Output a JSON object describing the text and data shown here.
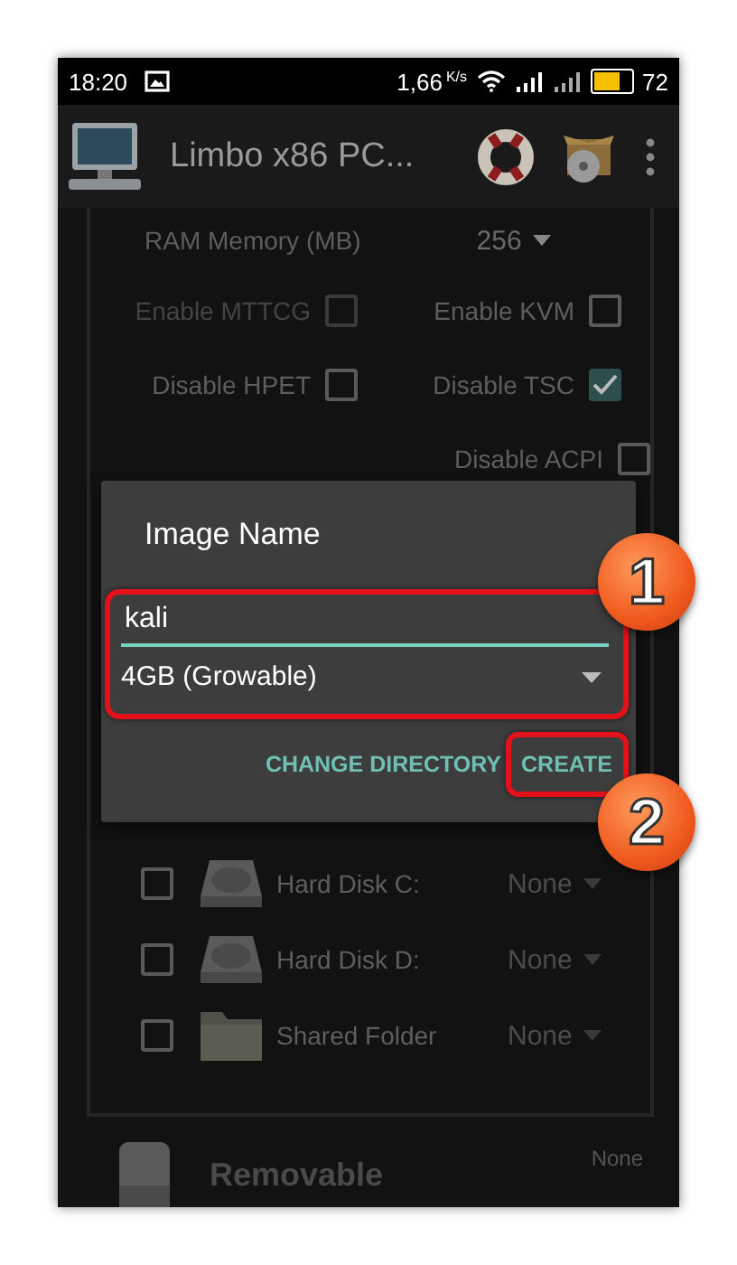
{
  "status_bar": {
    "time": "18:20",
    "speed": "1,66",
    "speed_unit": "K/s",
    "battery": "72"
  },
  "app_bar": {
    "title": "Limbo x86 PC..."
  },
  "ram": {
    "label": "RAM Memory (MB)",
    "value": "256"
  },
  "options": [
    {
      "label": "Enable  MTTCG",
      "checked": false,
      "disabled": true
    },
    {
      "label": "Enable KVM",
      "checked": false,
      "disabled": false
    },
    {
      "label": "Disable HPET",
      "checked": false,
      "disabled": false
    },
    {
      "label": "Disable TSC",
      "checked": true,
      "disabled": false
    },
    {
      "label": "Disable ACPI",
      "checked": false,
      "disabled": false
    }
  ],
  "drives": [
    {
      "kind": "disk",
      "label": "Hard Disk C:",
      "value": "None",
      "checked": false
    },
    {
      "kind": "disk",
      "label": "Hard Disk D:",
      "value": "None",
      "checked": false
    },
    {
      "kind": "folder",
      "label": "Shared Folder",
      "value": "None",
      "checked": false
    }
  ],
  "removable": {
    "title": "Removable",
    "value": "None"
  },
  "dialog": {
    "title": "Image Name",
    "input_value": "kali",
    "size_select": "4GB (Growable)",
    "buttons": [
      "CHANGE DIRECTORY",
      "CREATE"
    ]
  },
  "annotations": [
    {
      "number": "1"
    },
    {
      "number": "2"
    }
  ]
}
